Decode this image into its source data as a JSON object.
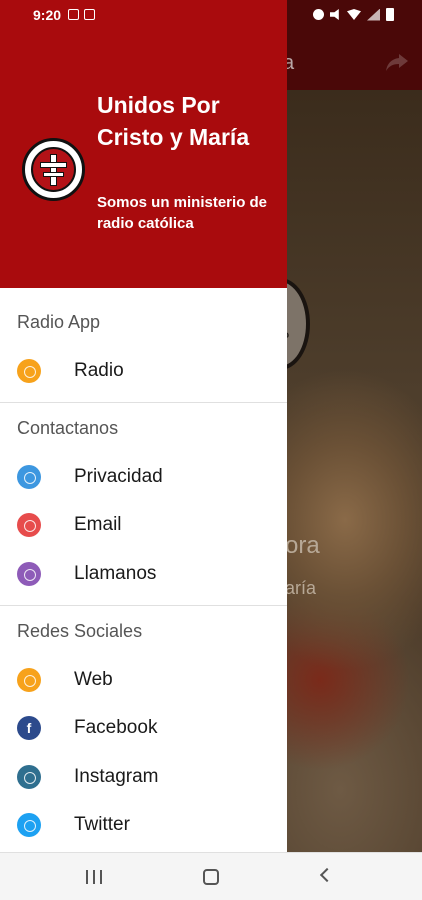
{
  "status_bar": {
    "time": "9:20"
  },
  "background_app": {
    "toolbar_title_fragment": "a",
    "image_text_line1": "ora",
    "image_text_line2": "aría",
    "logo_text_fragment": "o"
  },
  "drawer": {
    "header": {
      "title": "Unidos Por Cristo y María",
      "subtitle": "Somos un ministerio de radio católica",
      "color": "#a90b0d"
    },
    "sections": [
      {
        "label": "Radio App",
        "items": [
          {
            "label": "Radio",
            "icon": "radio-icon",
            "color": "#f7a21b"
          }
        ]
      },
      {
        "label": "Contactanos",
        "items": [
          {
            "label": "Privacidad",
            "icon": "privacy-icon",
            "color": "#3d97e0"
          },
          {
            "label": "Email",
            "icon": "email-icon",
            "color": "#e74c4c"
          },
          {
            "label": "Llamanos",
            "icon": "phone-icon",
            "color": "#8e5bb8"
          }
        ]
      },
      {
        "label": "Redes Sociales",
        "items": [
          {
            "label": "Web",
            "icon": "web-icon",
            "color": "#f7a21b"
          },
          {
            "label": "Facebook",
            "icon": "facebook-icon",
            "color": "#2c4a8c",
            "glyph": "f"
          },
          {
            "label": "Instagram",
            "icon": "instagram-icon",
            "color": "#2f6f8f"
          },
          {
            "label": "Twitter",
            "icon": "twitter-icon",
            "color": "#1da1f2"
          }
        ]
      }
    ]
  }
}
